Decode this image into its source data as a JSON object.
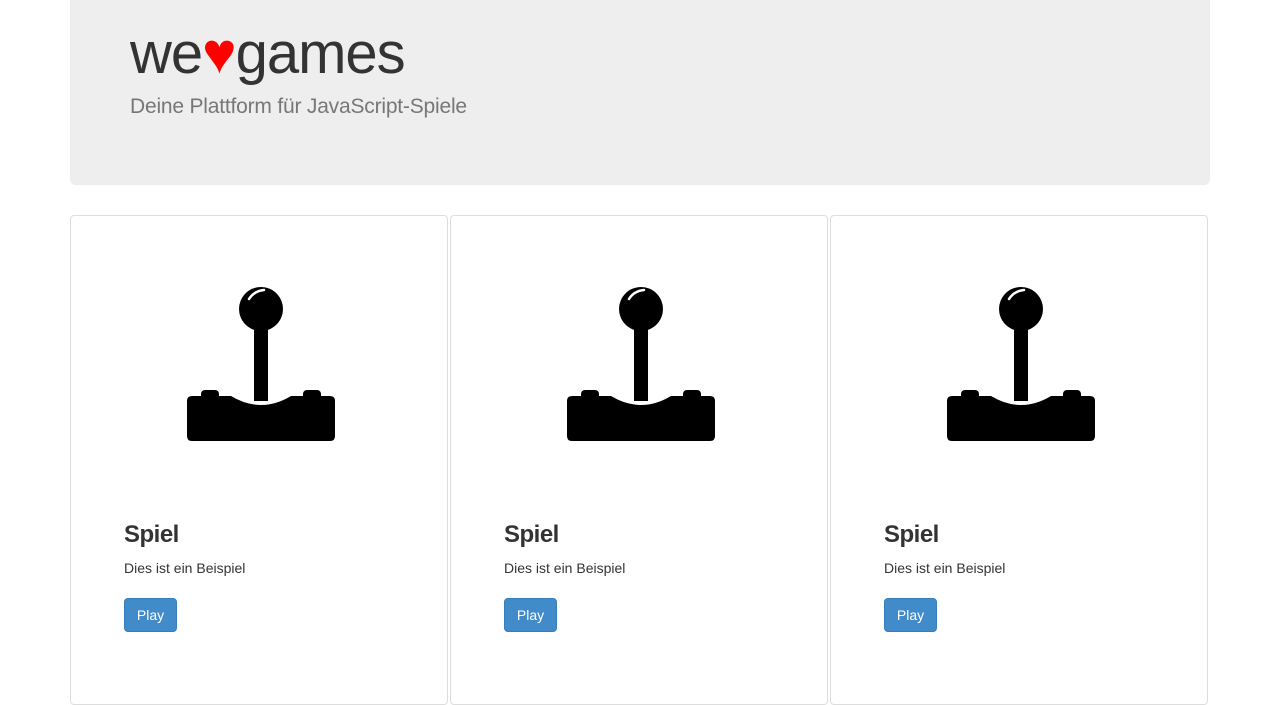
{
  "header": {
    "brand_prefix": "we",
    "brand_heart": "♥",
    "brand_suffix": "games",
    "tagline": "Deine Plattform für JavaScript-Spiele"
  },
  "colors": {
    "heart": "#ff0000",
    "jumbotron_bg": "#eeeeee",
    "button_bg": "#428bca"
  },
  "games": [
    {
      "icon": "joystick-icon",
      "title": "Spiel",
      "description": "Dies ist ein Beispiel",
      "button_label": "Play"
    },
    {
      "icon": "joystick-icon",
      "title": "Spiel",
      "description": "Dies ist ein Beispiel",
      "button_label": "Play"
    },
    {
      "icon": "joystick-icon",
      "title": "Spiel",
      "description": "Dies ist ein Beispiel",
      "button_label": "Play"
    }
  ]
}
